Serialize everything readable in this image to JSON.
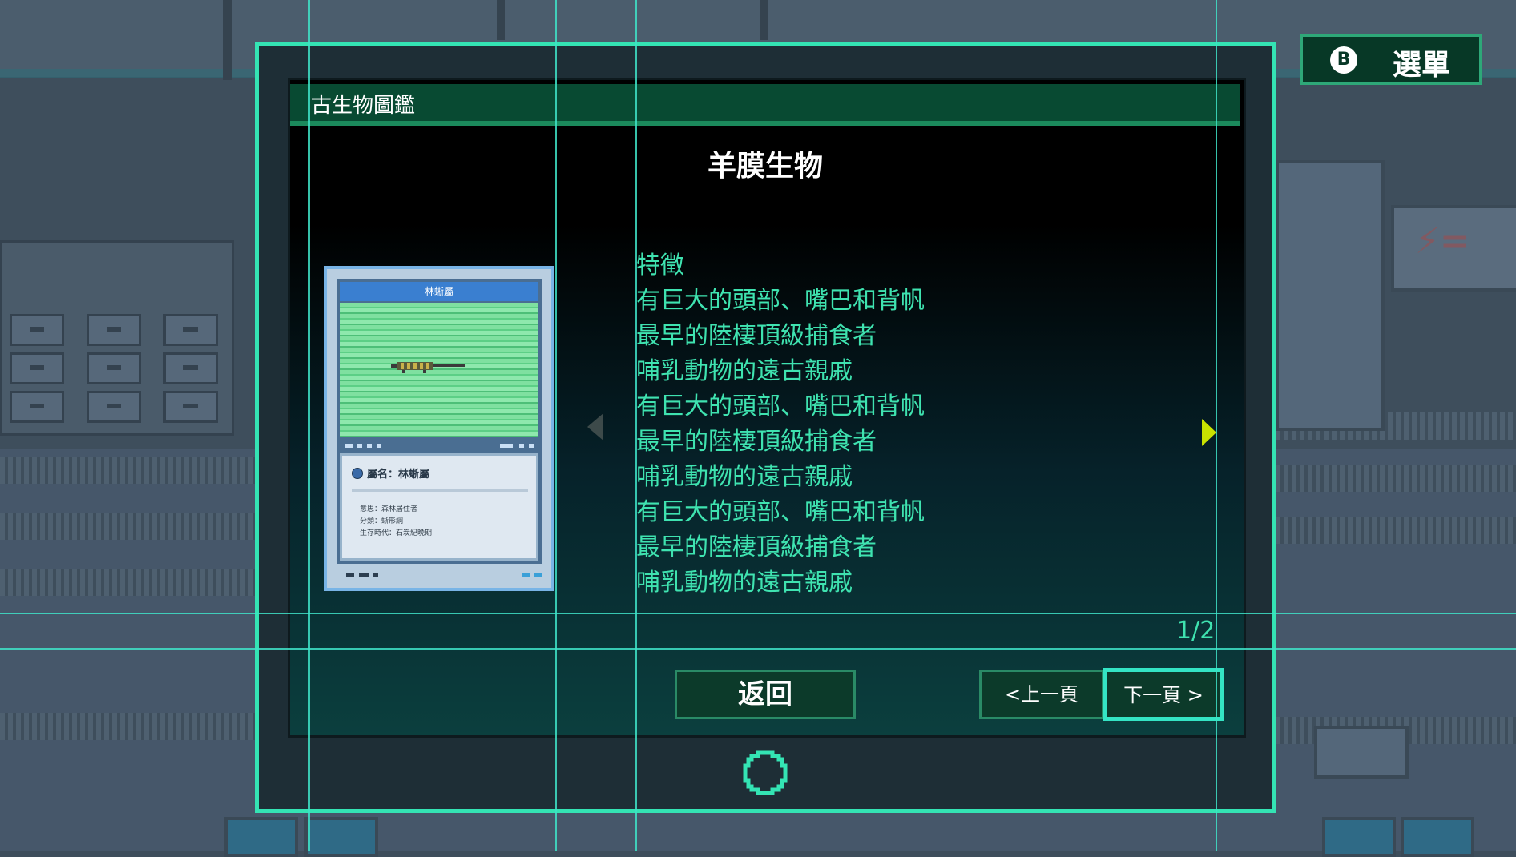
{
  "menu": {
    "key": "B",
    "label": "選單"
  },
  "window": {
    "title": "古生物圖鑑"
  },
  "creature": {
    "name": "羊膜生物"
  },
  "description": {
    "lines": [
      "特徵",
      "有巨大的頭部、嘴巴和背帆",
      "最早的陸棲頂級捕食者",
      "哺乳動物的遠古親戚",
      "有巨大的頭部、嘴巴和背帆",
      "最早的陸棲頂級捕食者",
      "哺乳動物的遠古親戚",
      "有巨大的頭部、嘴巴和背帆",
      "最早的陸棲頂級捕食者",
      "哺乳動物的遠古親戚"
    ]
  },
  "card": {
    "header": "林蜥屬",
    "genus": "屬名：林蜥屬",
    "facts": [
      "意思：森林居住者",
      "分類：蜥形綱",
      "生存時代：石炭紀晚期"
    ]
  },
  "pagination": {
    "indicator": "1/2"
  },
  "buttons": {
    "back": "返回",
    "prev": "<上一頁",
    "next": "下一頁 >"
  },
  "icons": {
    "left_arrow": "triangle-left-icon",
    "right_arrow": "triangle-right-icon",
    "loading": "loading-ring-icon"
  },
  "colors": {
    "accent": "#34e4b4",
    "text_green": "#3fe3b0",
    "title_bar": "#084a32",
    "arrow_active": "#c9e200"
  }
}
